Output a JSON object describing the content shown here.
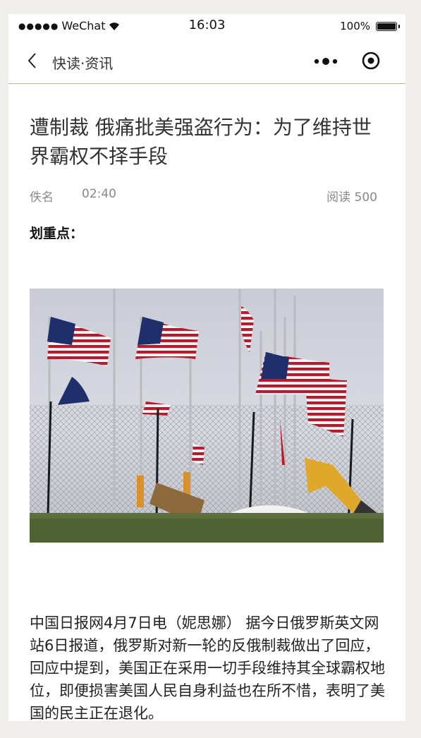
{
  "status_bar": {
    "signal_dots": "●●●●●",
    "carrier": "WeChat",
    "time": "16:03",
    "battery": "100%"
  },
  "nav": {
    "title": "快读·资讯",
    "more_icon": "more-dots-icon",
    "mini_program_icon": "target-icon"
  },
  "article": {
    "title": "遭制裁 俄痛批美强盗行为：为了维持世界霸权不择手段",
    "author": "佚名",
    "time": "02:40",
    "reads": "阅读 500",
    "highlight_title": "划重点：",
    "image_description_icon": "flags-photo",
    "body": "中国日报网4月7日电（妮思娜） 据今日俄罗斯英文网站6日报道，俄罗斯对新一轮的反俄制裁做出了回应，回应中提到，美国正在采用一切手段维持其全球霸权地位，即便损害美国人民自身利益也在所不惜，表明了美国的民主正在退化。"
  }
}
